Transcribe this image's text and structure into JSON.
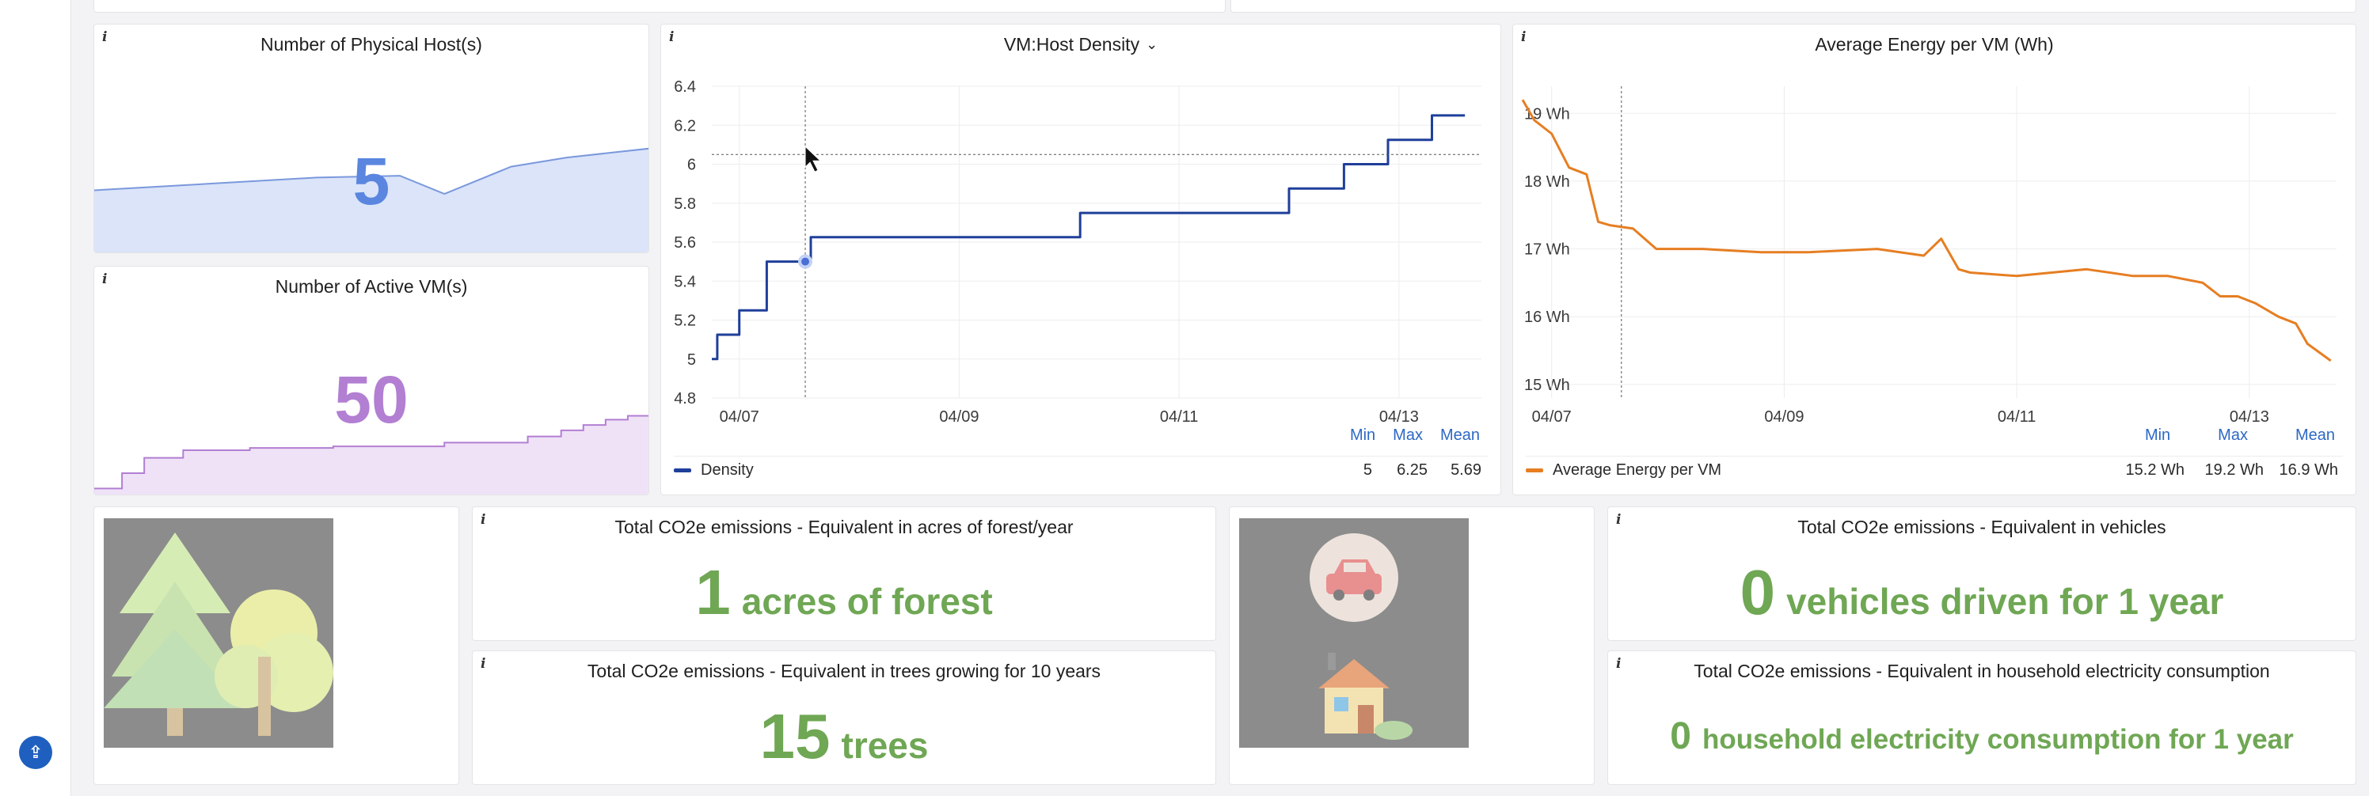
{
  "sidebar": {
    "help_icon": "user-help-icon"
  },
  "panels": {
    "hosts": {
      "title": "Number of Physical Host(s)",
      "value": "5",
      "color": "#5a86e0",
      "spark_fill": "#dbe4f9"
    },
    "vms": {
      "title": "Number of Active VM(s)",
      "value": "50",
      "color": "#b27fd3",
      "spark_fill": "#efe2f7"
    },
    "density": {
      "title": "VM:Host Density",
      "dropdown_icon": "chevron-down-icon",
      "legend": {
        "name": "Density",
        "min_label": "Min",
        "max_label": "Max",
        "mean_label": "Mean",
        "min": "5",
        "max": "6.25",
        "mean": "5.69"
      }
    },
    "energy": {
      "title": "Average Energy per VM (Wh)",
      "legend": {
        "name": "Average Energy per VM",
        "min_label": "Min",
        "max_label": "Max",
        "mean_label": "Mean",
        "min": "15.2 Wh",
        "max": "19.2 Wh",
        "mean": "16.9 Wh"
      }
    },
    "forest": {
      "title": "Total CO2e emissions - Equivalent in acres of forest/year",
      "value": "1",
      "unit": "acres of forest"
    },
    "trees": {
      "title": "Total CO2e emissions - Equivalent in trees growing for 10 years",
      "value": "15",
      "unit": "trees"
    },
    "vehicles": {
      "title": "Total CO2e emissions - Equivalent in vehicles",
      "value": "0",
      "unit": "vehicles driven for 1 year"
    },
    "household": {
      "title": "Total CO2e emissions - Equivalent in household electricity consumption",
      "value": "0",
      "unit": "household electricity consumption for 1 year"
    }
  },
  "chart_data": [
    {
      "type": "line",
      "title": "VM:Host Density",
      "ylim": [
        4.8,
        6.4
      ],
      "yticks": [
        "6.4",
        "6.2",
        "6",
        "5.8",
        "5.6",
        "5.4",
        "5.2",
        "5",
        "4.8"
      ],
      "xticks": [
        "04/07",
        "04/09",
        "04/11",
        "04/13"
      ],
      "xrange": [
        6.75,
        13.75
      ],
      "series": [
        {
          "name": "Density",
          "color": "#1f3f9a",
          "x": [
            6.75,
            6.8,
            7.0,
            7.25,
            7.6,
            7.65,
            9.0,
            10.0,
            10.1,
            12.0,
            12.5,
            12.9,
            13.3,
            13.6
          ],
          "values": [
            5.0,
            5.125,
            5.25,
            5.5,
            5.5,
            5.625,
            5.625,
            5.625,
            5.75,
            5.875,
            6.0,
            6.125,
            6.25,
            6.25
          ]
        }
      ],
      "grid": true,
      "legend_placement": "bottom"
    },
    {
      "type": "line",
      "title": "Average Energy per VM (Wh)",
      "ylim": [
        14.8,
        19.4
      ],
      "yticks": [
        "19 Wh",
        "18 Wh",
        "17 Wh",
        "16 Wh",
        "15 Wh"
      ],
      "xticks": [
        "04/07",
        "04/09",
        "04/11",
        "04/13"
      ],
      "xrange": [
        6.75,
        13.75
      ],
      "series": [
        {
          "name": "Average Energy per VM",
          "color": "#e67e22",
          "x": [
            6.75,
            6.85,
            7.0,
            7.15,
            7.3,
            7.4,
            7.5,
            7.7,
            7.9,
            8.3,
            8.8,
            9.2,
            9.8,
            10.2,
            10.35,
            10.5,
            10.6,
            11.0,
            11.6,
            12.0,
            12.3,
            12.6,
            12.75,
            12.9,
            13.05,
            13.25,
            13.4,
            13.5,
            13.7
          ],
          "values": [
            19.2,
            18.9,
            18.7,
            18.2,
            18.1,
            17.4,
            17.35,
            17.3,
            17.0,
            17.0,
            16.95,
            16.95,
            17.0,
            16.9,
            17.15,
            16.7,
            16.65,
            16.6,
            16.7,
            16.6,
            16.6,
            16.5,
            16.3,
            16.3,
            16.2,
            16.0,
            15.9,
            15.6,
            15.35
          ]
        }
      ],
      "grid": true,
      "legend_placement": "bottom"
    },
    {
      "type": "area",
      "title": "Number of Physical Host(s)",
      "x": [
        0,
        0.4,
        0.55,
        0.63,
        0.75,
        0.85,
        1.0
      ],
      "values": [
        3.5,
        4.2,
        4.3,
        3.3,
        4.8,
        5.3,
        5.8
      ],
      "ylim": [
        0,
        10
      ]
    },
    {
      "type": "area",
      "title": "Number of Active VM(s)",
      "x": [
        0,
        0.05,
        0.09,
        0.16,
        0.28,
        0.43,
        0.63,
        0.78,
        0.84,
        0.88,
        0.92,
        0.96,
        1.0
      ],
      "values": [
        1,
        3,
        5,
        6,
        6.3,
        6.5,
        7,
        7.8,
        8.6,
        9.3,
        10,
        10.5,
        11
      ],
      "ylim": [
        0,
        30
      ]
    }
  ]
}
